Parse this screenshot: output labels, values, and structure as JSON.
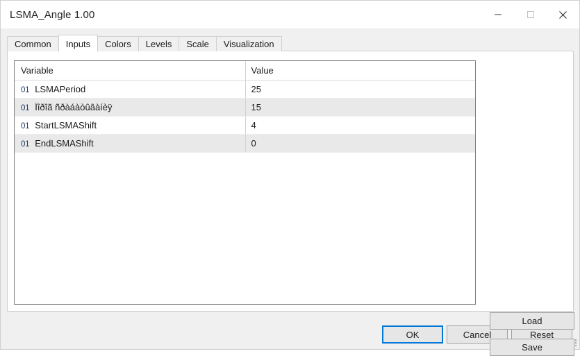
{
  "window": {
    "title": "LSMA_Angle 1.00",
    "controls": [
      {
        "name": "minimize",
        "glyph": "minimize-icon"
      },
      {
        "name": "maximize",
        "glyph": "maximize-icon"
      },
      {
        "name": "close",
        "glyph": "close-icon"
      }
    ]
  },
  "tabs": [
    {
      "label": "Common",
      "active": false
    },
    {
      "label": "Inputs",
      "active": true
    },
    {
      "label": "Colors",
      "active": false
    },
    {
      "label": "Levels",
      "active": false
    },
    {
      "label": "Scale",
      "active": false
    },
    {
      "label": "Visualization",
      "active": false
    }
  ],
  "table": {
    "headers": {
      "variable": "Variable",
      "value": "Value"
    },
    "row_icon": "01",
    "rows": [
      {
        "icon": "01",
        "variable": "LSMAPeriod",
        "value": "25"
      },
      {
        "icon": "01",
        "variable": "Ïîðîã ñðàáàòûâàíèÿ",
        "value": "15"
      },
      {
        "icon": "01",
        "variable": "StartLSMAShift",
        "value": "4"
      },
      {
        "icon": "01",
        "variable": "EndLSMAShift",
        "value": "0"
      }
    ]
  },
  "side_buttons": {
    "load": "Load",
    "save": "Save"
  },
  "bottom_buttons": {
    "ok": "OK",
    "cancel": "Cancel",
    "reset": "Reset"
  },
  "colors": {
    "accent": "#0078d7",
    "icon_blue": "#1f3864",
    "window_bg": "#f0f0f0",
    "panel_bg": "#ffffff",
    "alt_row": "#e9e9e9",
    "button_face": "#e6e6e6"
  }
}
